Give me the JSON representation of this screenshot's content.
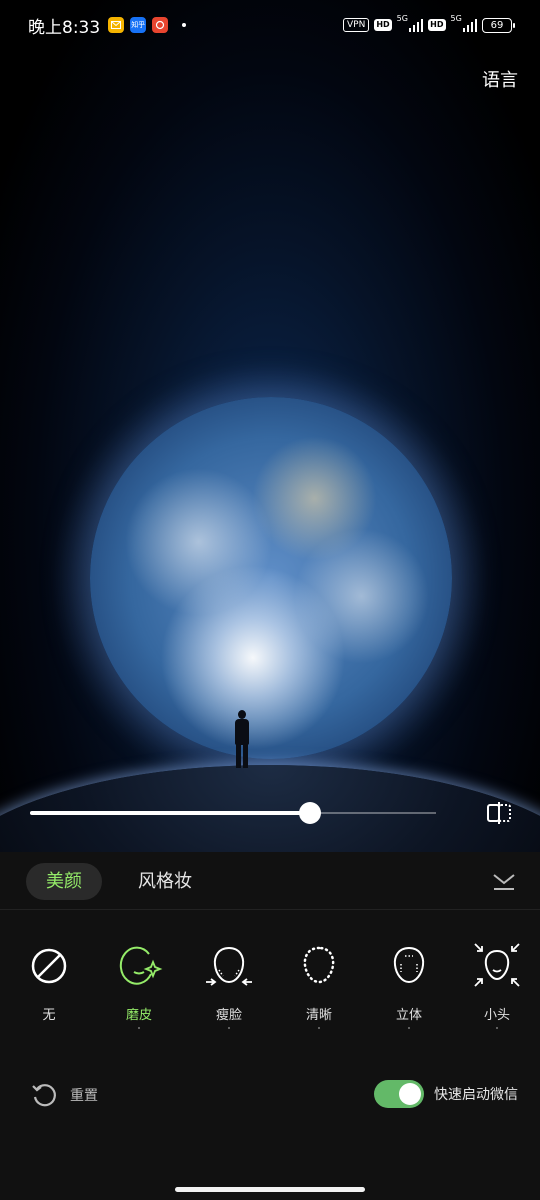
{
  "status_bar": {
    "time": "晚上8:33",
    "app_icons": [
      "mail-icon",
      "zhihu-icon",
      "shop-icon"
    ],
    "zhihu_label": "知乎",
    "vpn": "VPN",
    "hd": "HD",
    "network": "5G",
    "battery": "69"
  },
  "header": {
    "language_button": "语言"
  },
  "slider": {
    "value": 0.69
  },
  "tabs": [
    {
      "label": "美颜",
      "active": true
    },
    {
      "label": "风格妆",
      "active": false
    }
  ],
  "tools": [
    {
      "label": "无",
      "icon": "none-icon",
      "active": false
    },
    {
      "label": "磨皮",
      "icon": "smooth-skin-icon",
      "active": true
    },
    {
      "label": "瘦脸",
      "icon": "slim-face-icon",
      "active": false
    },
    {
      "label": "清晰",
      "icon": "clarity-icon",
      "active": false
    },
    {
      "label": "立体",
      "icon": "contour-icon",
      "active": false
    },
    {
      "label": "小头",
      "icon": "small-head-icon",
      "active": false
    }
  ],
  "footer": {
    "reset_label": "重置",
    "quick_launch_label": "快速启动微信",
    "quick_launch_enabled": true
  },
  "colors": {
    "accent_green": "#95ec69",
    "toggle_green": "#63b968",
    "panel_bg": "#111111"
  }
}
